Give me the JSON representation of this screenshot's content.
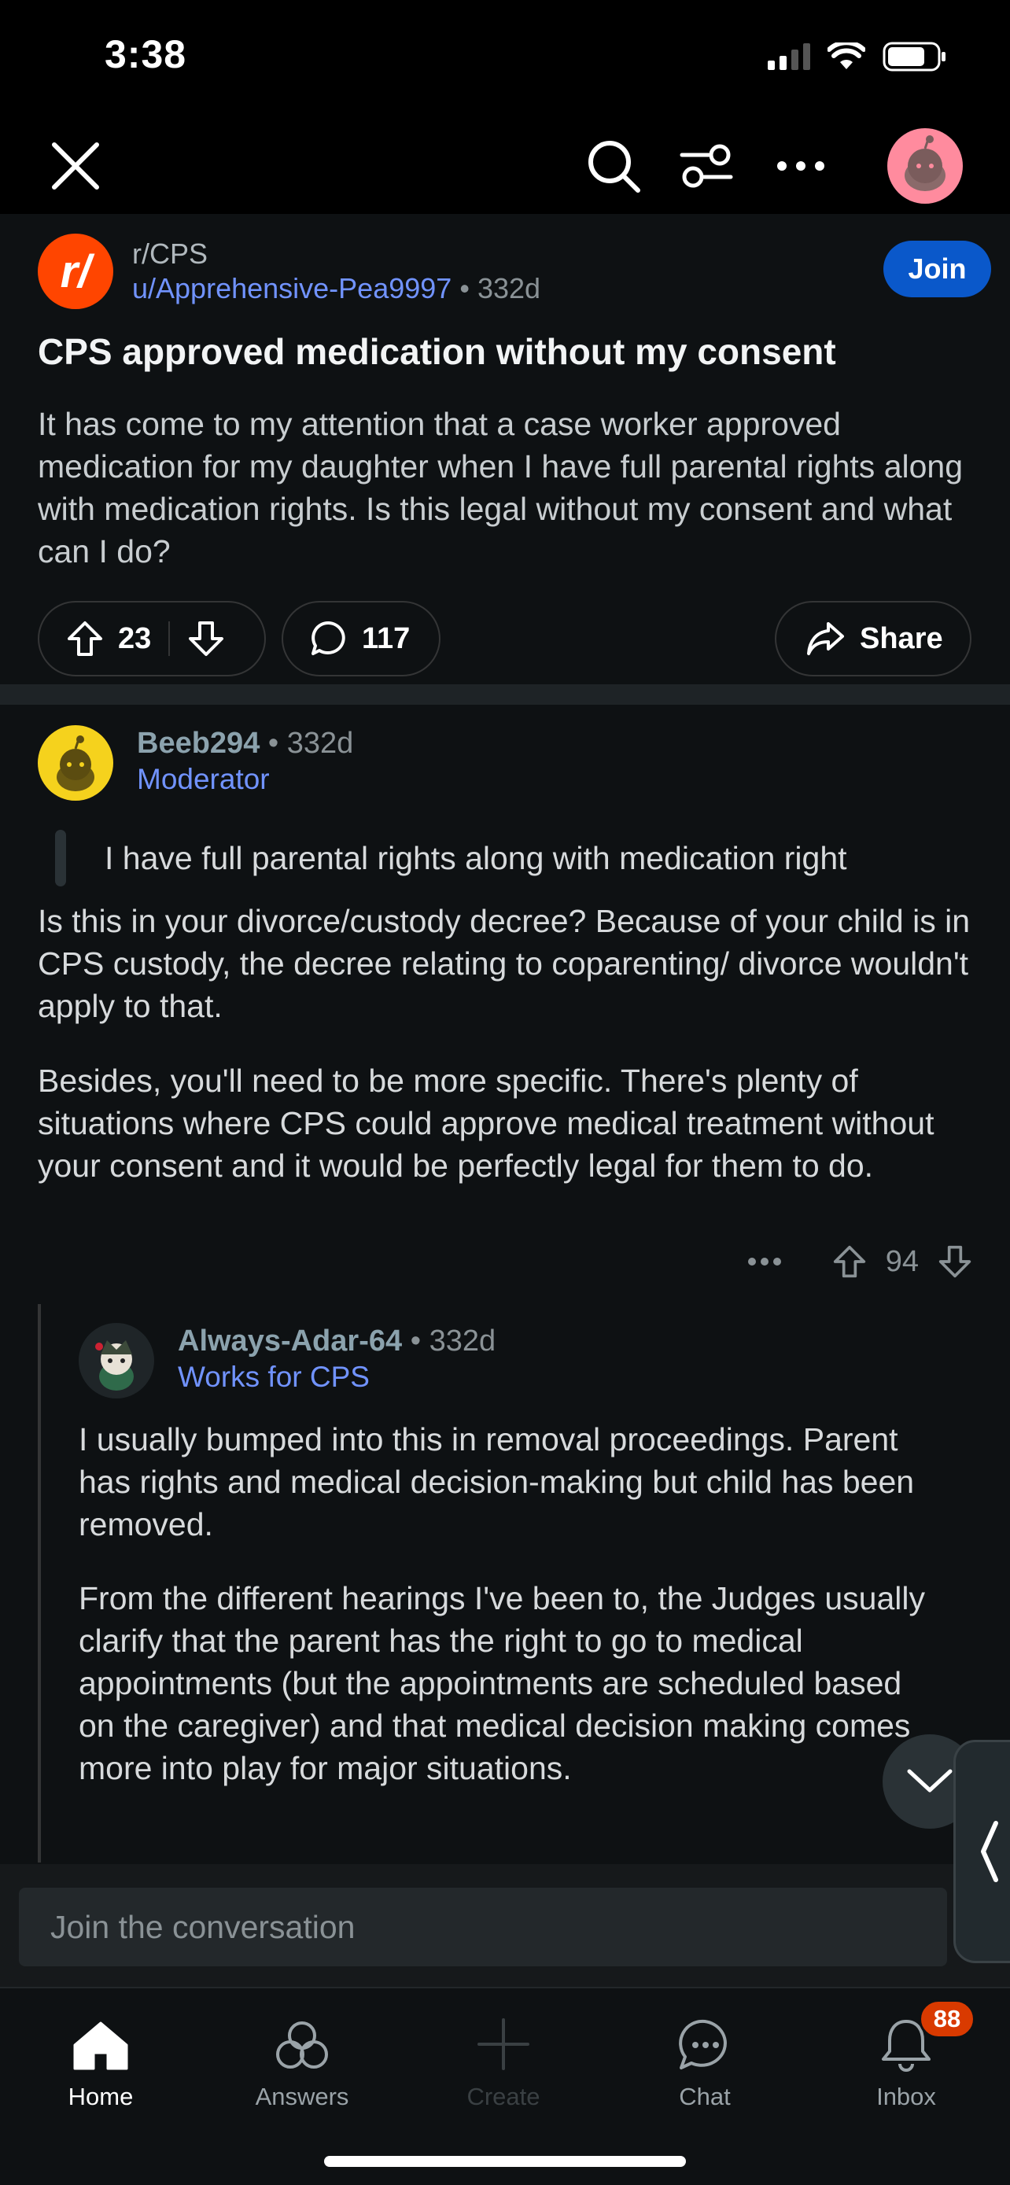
{
  "status_bar": {
    "time": "3:38"
  },
  "post": {
    "subreddit": "r/CPS",
    "subreddit_icon_glyph": "r/",
    "author": "u/Apprehensive-Pea9997",
    "separator": "•",
    "age": "332d",
    "join_label": "Join",
    "title": "CPS approved medication without my consent",
    "body": "It has come to my attention that a case worker approved medication for my daughter when I have full parental rights along with medication rights. Is this legal without my consent and what can I do?",
    "upvotes": "23",
    "comments": "117",
    "share_label": "Share"
  },
  "comments": [
    {
      "username": "Beeb294",
      "separator": "•",
      "age": "332d",
      "flair": "Moderator",
      "quote": "I have full parental rights along with medication right",
      "paragraphs": [
        "Is this in your divorce/custody decree? Because of your child is in CPS custody, the decree relating to coparenting/ divorce wouldn't apply to that.",
        "Besides, you'll need to be more specific. There's plenty of situations where CPS could approve medical treatment without your consent and it would be perfectly legal for them to do."
      ],
      "score": "94"
    },
    {
      "username": "Always-Adar-64",
      "separator": "•",
      "age": "332d",
      "flair": "Works for CPS",
      "paragraphs": [
        "I usually bumped into this in removal proceedings. Parent has rights and medical decision-making but child has been removed.",
        "From the different hearings I've been to, the Judges usually clarify that the parent has the right to go to medical appointments (but the appointments are scheduled based on the caregiver) and that medical decision making comes more into play for major situations."
      ]
    }
  ],
  "composer": {
    "placeholder": "Join the conversation"
  },
  "tabs": [
    {
      "label": "Home",
      "icon": "home-icon"
    },
    {
      "label": "Answers",
      "icon": "answers-icon"
    },
    {
      "label": "Create",
      "icon": "plus-icon"
    },
    {
      "label": "Chat",
      "icon": "chat-icon"
    },
    {
      "label": "Inbox",
      "icon": "bell-icon",
      "badge": "88"
    }
  ],
  "colors": {
    "background": "#0e1113",
    "accent_blue": "#0a58ca",
    "link_blue": "#7193ff",
    "subreddit_orange": "#ff4500",
    "badge_red": "#d93a00"
  }
}
